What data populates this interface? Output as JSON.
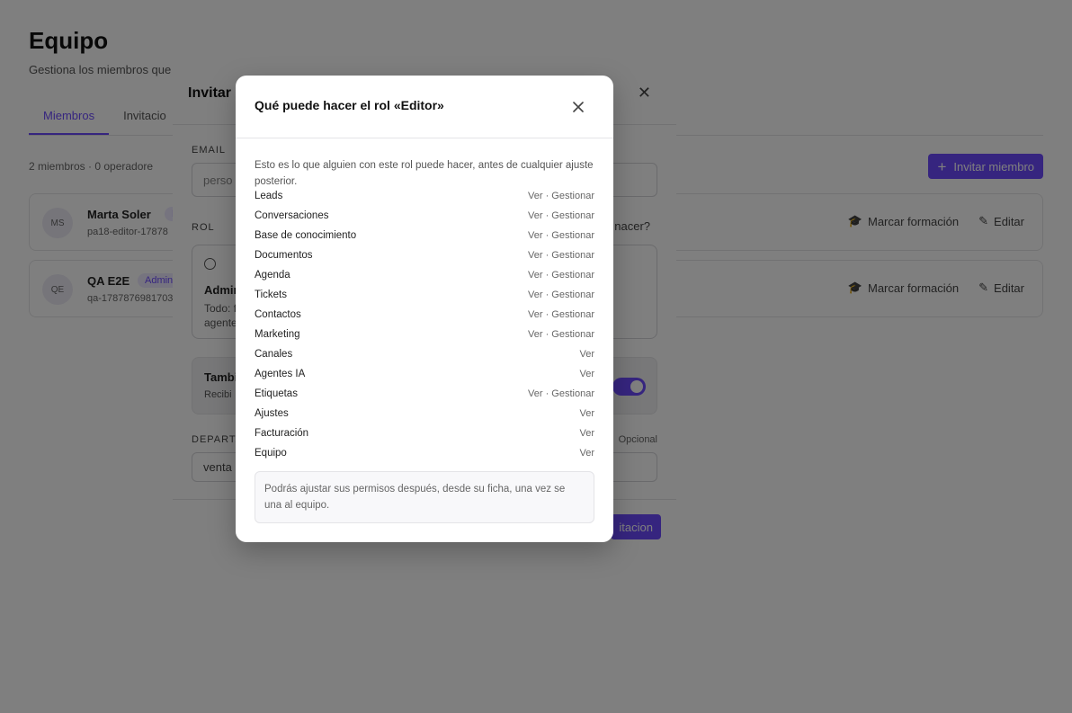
{
  "page": {
    "title": "Equipo",
    "subtitle": "Gestiona los miembros que",
    "tabs": [
      "Miembros",
      "Invitacio"
    ],
    "member_count": "2 miembros · 0 operadore",
    "invite_button": "Invitar miembro",
    "members": [
      {
        "initials": "MS",
        "name": "Marta Soler",
        "badge": "E",
        "email": "pa18-editor-17878",
        "train": "Marcar formación",
        "edit": "Editar"
      },
      {
        "initials": "QE",
        "name": "QA E2E",
        "badge": "Admin",
        "email": "qa-1787876981703",
        "train": "Marcar formación",
        "edit": "Editar"
      }
    ]
  },
  "invite_modal": {
    "title": "Invitar m",
    "email_label": "Email",
    "email_placeholder": "perso",
    "role_label": "Rol",
    "role_help": "nacer?",
    "role_name": "Admin",
    "role_desc": "Todo: f agente",
    "notify_title": "Tambi",
    "notify_desc": "Recibi",
    "department_label": "Departa",
    "department_value": "venta",
    "optional": "Opcional",
    "submit": "itacion"
  },
  "role_modal": {
    "title": "Qué puede hacer el rol «Editor»",
    "intro": "Esto es lo que alguien con este rol puede hacer, antes de cualquier ajuste posterior.",
    "permissions": [
      {
        "name": "Leads",
        "value": "Ver · Gestionar"
      },
      {
        "name": "Conversaciones",
        "value": "Ver · Gestionar"
      },
      {
        "name": "Base de conocimiento",
        "value": "Ver · Gestionar"
      },
      {
        "name": "Documentos",
        "value": "Ver · Gestionar"
      },
      {
        "name": "Agenda",
        "value": "Ver · Gestionar"
      },
      {
        "name": "Tickets",
        "value": "Ver · Gestionar"
      },
      {
        "name": "Contactos",
        "value": "Ver · Gestionar"
      },
      {
        "name": "Marketing",
        "value": "Ver · Gestionar"
      },
      {
        "name": "Canales",
        "value": "Ver"
      },
      {
        "name": "Agentes IA",
        "value": "Ver"
      },
      {
        "name": "Etiquetas",
        "value": "Ver · Gestionar"
      },
      {
        "name": "Ajustes",
        "value": "Ver"
      },
      {
        "name": "Facturación",
        "value": "Ver"
      },
      {
        "name": "Equipo",
        "value": "Ver"
      }
    ],
    "note": "Podrás ajustar sus permisos después, desde su ficha, una vez se una al equipo."
  },
  "colors": {
    "accent": "#6d4aff",
    "overlay": "rgba(0,0,0,0.5)"
  }
}
